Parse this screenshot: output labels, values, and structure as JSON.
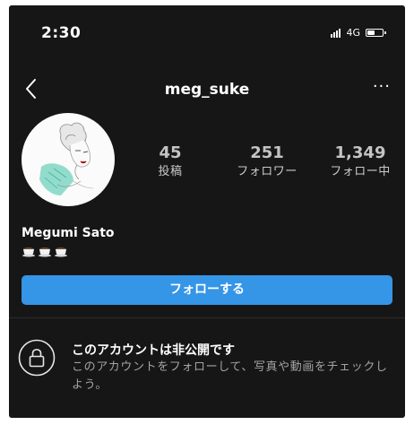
{
  "status_bar": {
    "time": "2:30",
    "network": "4G",
    "battery_level": 0.55
  },
  "nav": {
    "username": "meg_suke",
    "more": "···"
  },
  "profile": {
    "stats": [
      {
        "value": "45",
        "label": "投稿"
      },
      {
        "value": "251",
        "label": "フォロワー"
      },
      {
        "value": "1,349",
        "label": "フォロー中"
      }
    ],
    "display_name": "Megumi Sato",
    "bio_icons": [
      "coffee-cup-icon",
      "coffee-cup-icon",
      "coffee-cup-icon"
    ]
  },
  "follow_button": {
    "label": "フォローする"
  },
  "private_account": {
    "title": "このアカウントは非公開です",
    "description": "このアカウントをフォローして、写真や動画をチェックしよう。"
  },
  "colors": {
    "background": "#161616",
    "accent": "#3595e7",
    "secondary_text": "#a3a3a3"
  }
}
